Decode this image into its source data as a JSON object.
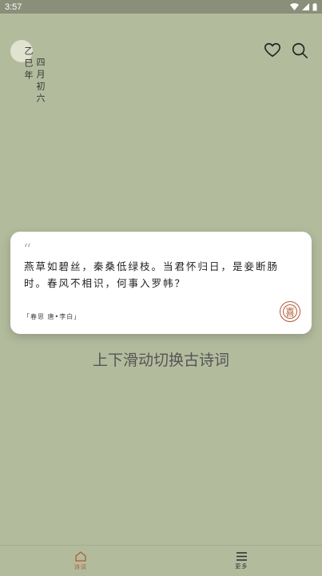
{
  "statusbar": {
    "time": "3:57"
  },
  "date": {
    "col1": "乙巳年",
    "col2": "四月初六"
  },
  "poem": {
    "quote": "“",
    "text": "燕草如碧丝，秦桑低绿枝。当君怀归日，是妾断肠时。春风不相识，何事入罗帏？",
    "source": "「春思 唐•李白」",
    "badge": "喜"
  },
  "hint": "上下滑动切换古诗词",
  "nav": {
    "items": [
      {
        "label": "诗词",
        "icon": "home-icon"
      },
      {
        "label": "更多",
        "icon": "menu-icon"
      }
    ]
  },
  "colors": {
    "background": "#b3bb9d",
    "accent": "#b25a3a",
    "card": "#ffffff"
  }
}
